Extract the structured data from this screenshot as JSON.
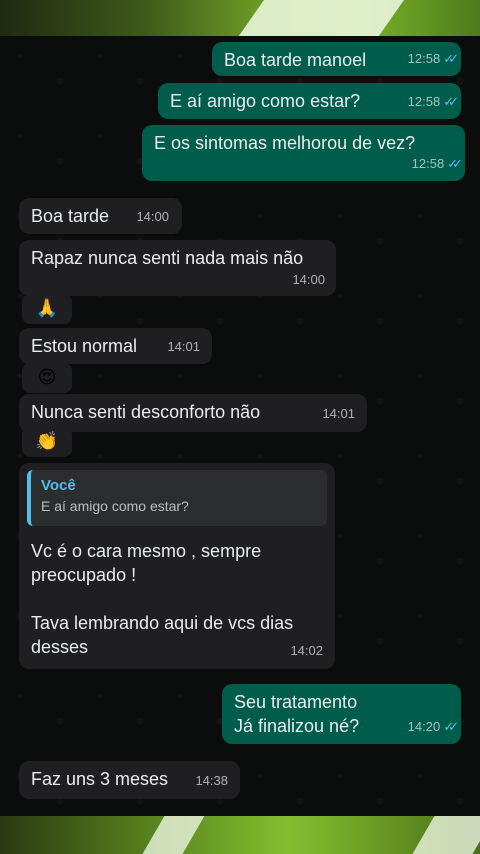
{
  "messages": {
    "m1": {
      "text": "Boa tarde manoel",
      "time": "12:58"
    },
    "m2": {
      "text": "E aí amigo como estar?",
      "time": "12:58"
    },
    "m3": {
      "text": "E os sintomas melhorou de vez?",
      "time": "12:58"
    },
    "m4": {
      "text": "Boa tarde",
      "time": "14:00"
    },
    "m5": {
      "text": "Rapaz nunca senti nada mais não",
      "time": "14:00"
    },
    "m6": {
      "emoji": "🙏"
    },
    "m7": {
      "text": "Estou normal",
      "time": "14:01"
    },
    "m8": {
      "emoji": "😍"
    },
    "m9": {
      "text": "Nunca senti desconforto não",
      "time": "14:01"
    },
    "m10": {
      "emoji": "👏"
    },
    "m11": {
      "quote_author": "Você",
      "quote_text": "E aí amigo como estar?",
      "text": "Vc é o cara mesmo , sempre\npreocupado !\n\nTava lembrando aqui de vcs dias\ndesses",
      "time": "14:02"
    },
    "m12": {
      "text": "Seu tratamento\nJá finalizou né?",
      "time": "14:20"
    },
    "m13": {
      "text": "Faz uns 3 meses",
      "time": "14:38"
    }
  },
  "icons": {
    "read_receipt": "double-check-icon"
  },
  "colors": {
    "outgoing": "#005c4b",
    "incoming": "#1f1f21",
    "read_check": "#53bdeb",
    "quote_accent": "#53bdeb"
  }
}
